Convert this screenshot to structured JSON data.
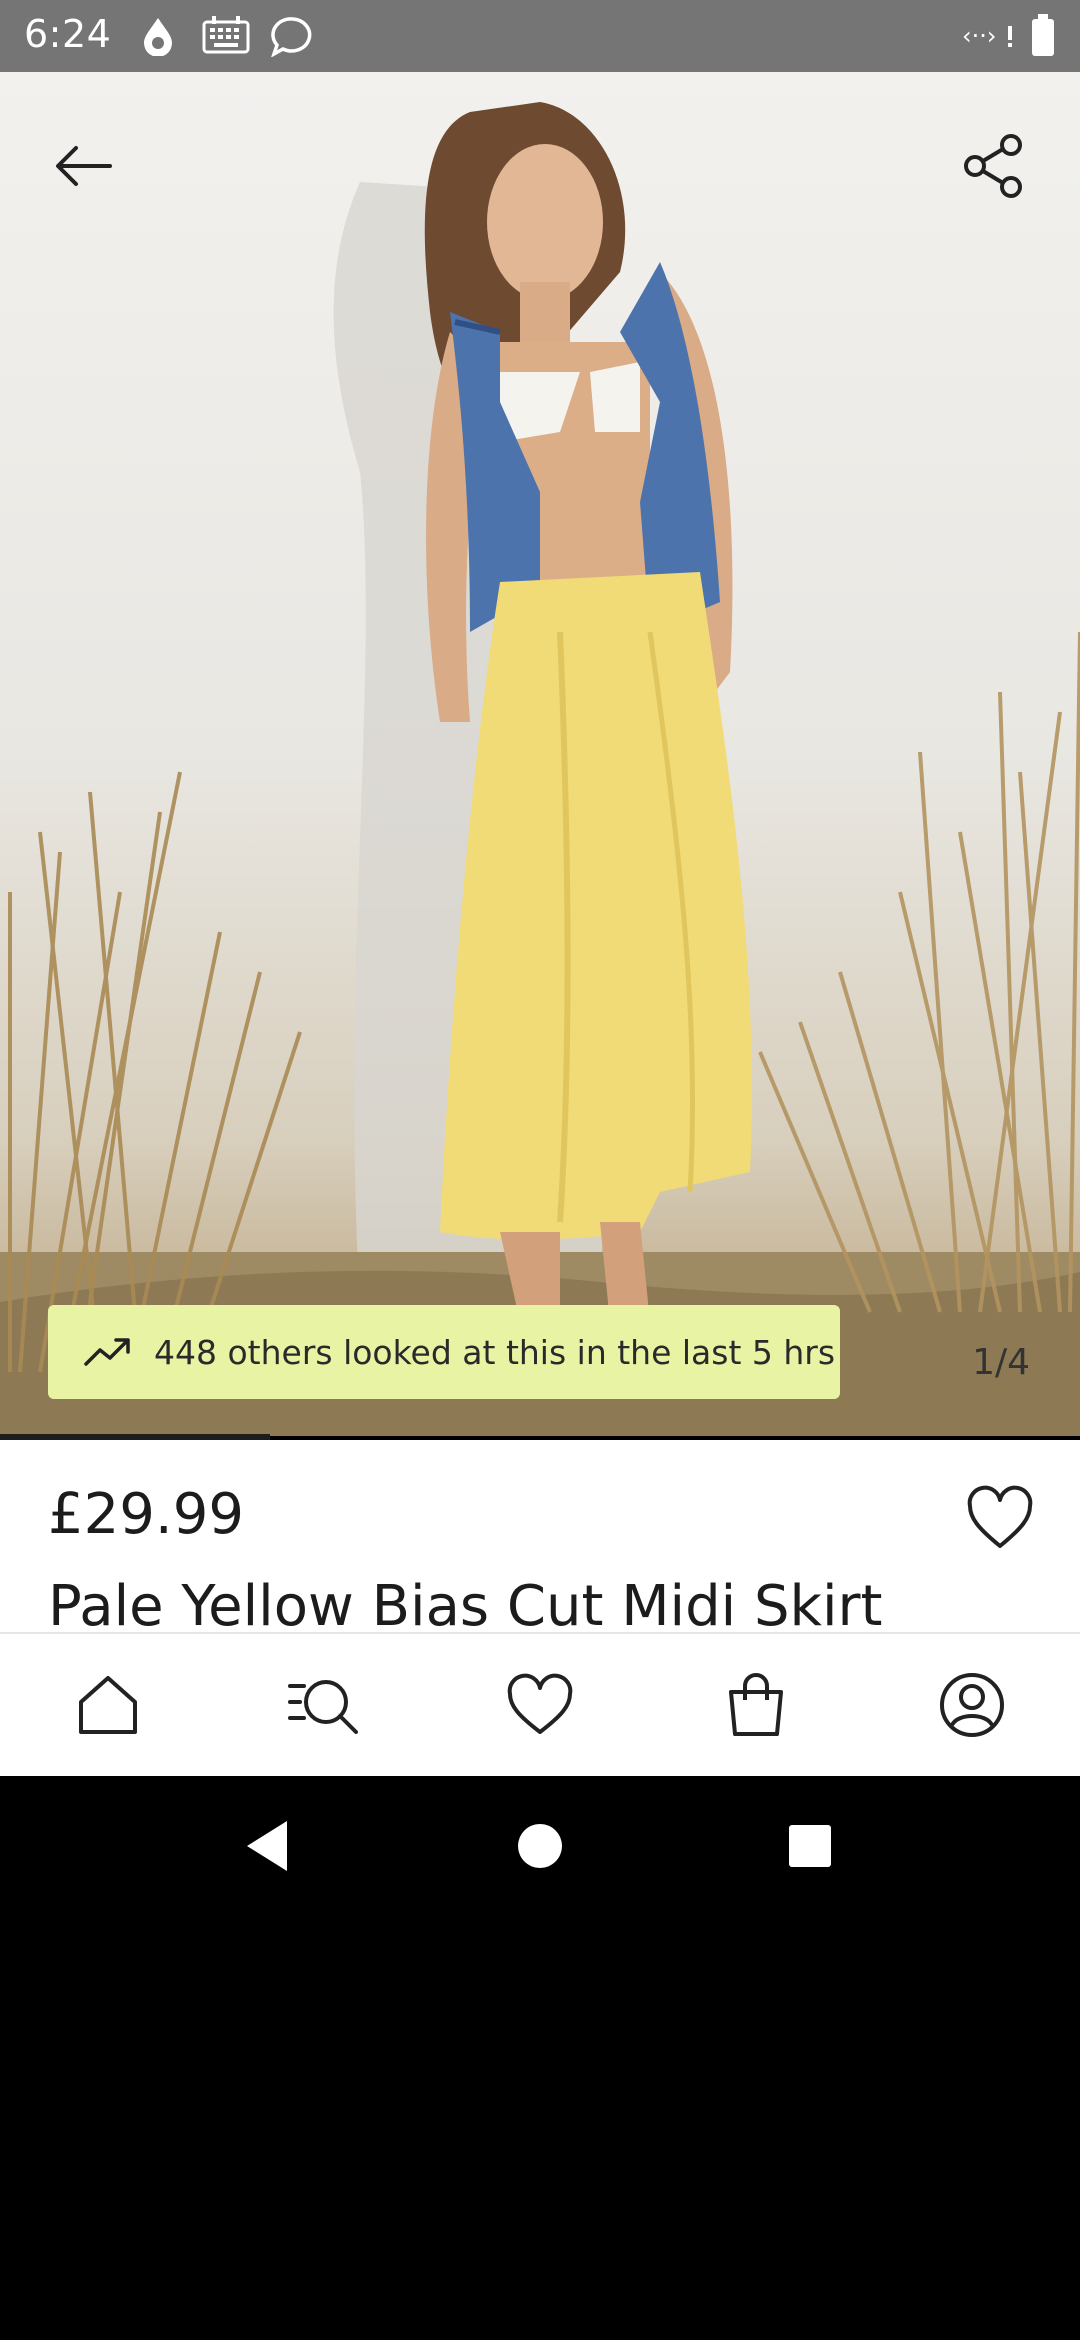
{
  "status_bar": {
    "time": "6:24",
    "icons": [
      "water-drop-icon",
      "keyboard-icon",
      "chat-bubble-icon",
      "wifi-calling-icon",
      "battery-icon"
    ]
  },
  "product": {
    "image_counter": "1/4",
    "popularity_text": "448 others looked at this in the last 5 hrs",
    "price": "£29.99",
    "title": "Pale Yellow Bias Cut Midi Skirt",
    "image_progress": 0.25
  },
  "top_actions": {
    "back_icon": "arrow-left-icon",
    "share_icon": "share-icon"
  },
  "bottom_nav": {
    "items": [
      "home-icon",
      "search-icon",
      "heart-icon",
      "shopping-bag-icon",
      "account-icon"
    ]
  },
  "colors": {
    "popularity_bg": "#e8f3a3",
    "status_bar": "#757575",
    "skirt": "#f1db77",
    "vest": "#4d73ad"
  }
}
